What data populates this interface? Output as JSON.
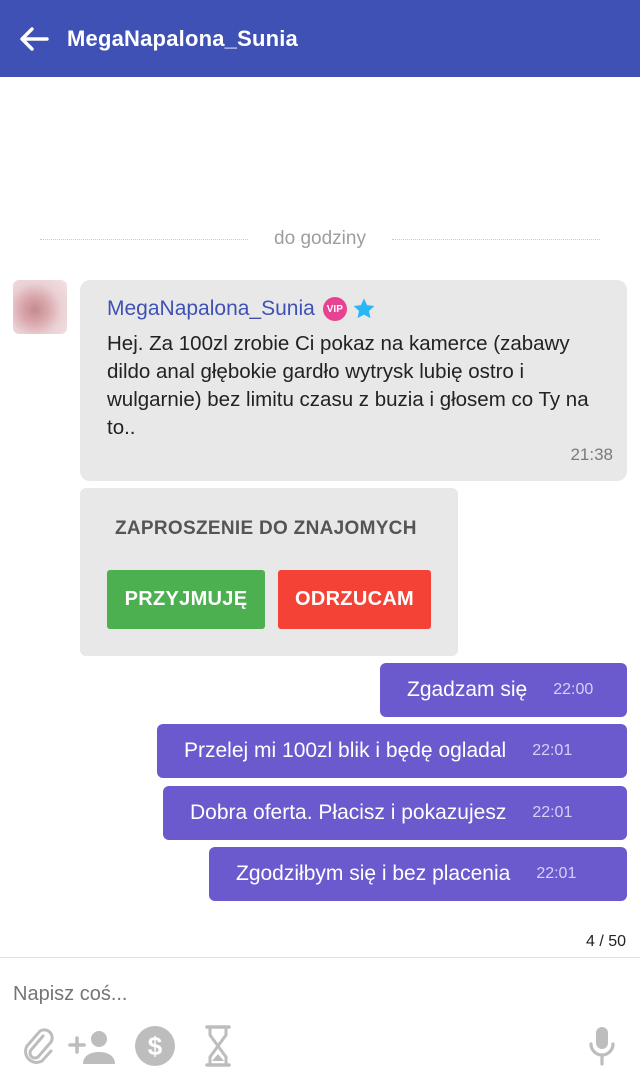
{
  "header": {
    "title": "MegaNapalona_Sunia",
    "back_icon": "arrow-left-icon"
  },
  "date_separator": "do godziny",
  "incoming": {
    "sender": "MegaNapalona_Sunia",
    "vip_badge": "VIP",
    "text": "Hej. Za 100zl zrobie Ci pokaz na kamerce (zabawy dildo anal głębokie gardło wytrysk lubię ostro i wulgarnie) bez limitu czasu z buzia i głosem co Ty na to..",
    "time": "21:38"
  },
  "invitation": {
    "title": "ZAPROSZENIE DO ZNAJOMYCH",
    "accept_label": "PRZYJMUJĘ",
    "reject_label": "ODRZUCAM"
  },
  "outgoing": [
    {
      "text": "Zgadzam się",
      "time": "22:00"
    },
    {
      "text": "Przelej mi 100zl blik i będę ogladal",
      "time": "22:01"
    },
    {
      "text": "Dobra oferta. Płacisz i pokazujesz",
      "time": "22:01"
    },
    {
      "text": "Zgodziłbym się i bez placenia",
      "time": "22:01"
    }
  ],
  "char_counter": "4 / 50",
  "composer": {
    "placeholder": "Napisz coś...",
    "icons": [
      "paperclip-icon",
      "add-person-icon",
      "dollar-icon",
      "hourglass-icon",
      "microphone-icon"
    ]
  },
  "colors": {
    "header": "#3f51b5",
    "outgoing": "#6a5acd",
    "incoming": "#e8e8e8",
    "accept": "#4caf50",
    "reject": "#f44336"
  }
}
